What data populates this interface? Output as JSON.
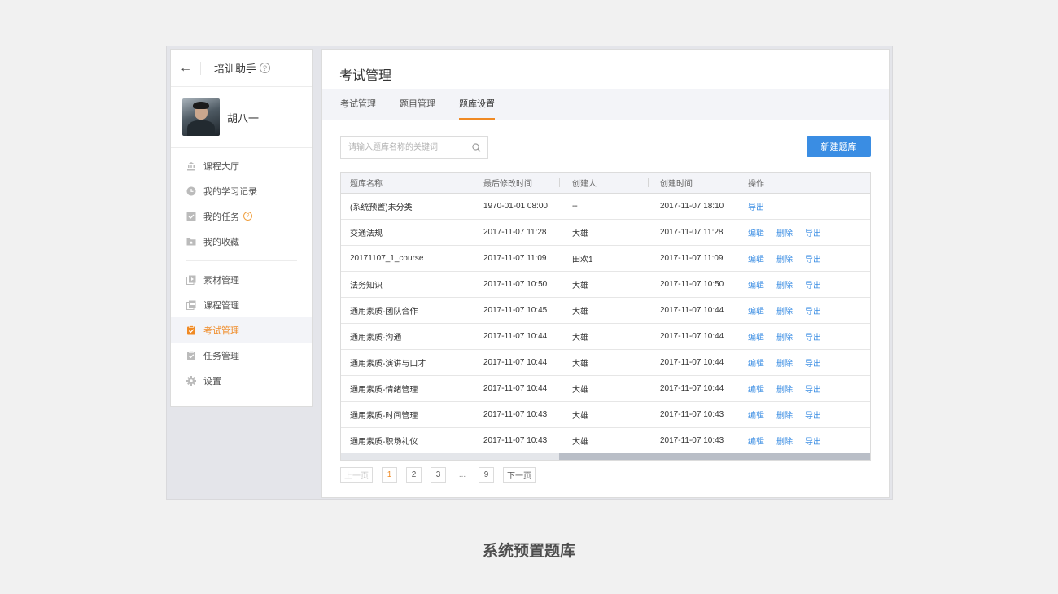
{
  "sidebar": {
    "app_title": "培训助手",
    "help_glyph": "?",
    "user_name": "胡八一",
    "items": [
      {
        "label": "课程大厅"
      },
      {
        "label": "我的学习记录"
      },
      {
        "label": "我的任务",
        "badge": "?"
      },
      {
        "label": "我的收藏"
      },
      {
        "label": "素材管理"
      },
      {
        "label": "课程管理"
      },
      {
        "label": "考试管理",
        "active": true
      },
      {
        "label": "任务管理"
      },
      {
        "label": "设置"
      }
    ]
  },
  "main": {
    "title": "考试管理",
    "tabs": [
      "考试管理",
      "题目管理",
      "题库设置"
    ],
    "active_tab": "题库设置",
    "search_placeholder": "请输入题库名称的关键词",
    "new_button": "新建题库",
    "table": {
      "columns": [
        "题库名称",
        "最后修改时间",
        "创建人",
        "创建时间",
        "操作"
      ],
      "rows": [
        {
          "name": "(系统预置)未分类",
          "modified": "1970-01-01 08:00",
          "creator": "--",
          "created": "2017-11-07 18:10",
          "ops": [
            "导出"
          ]
        },
        {
          "name": "交通法规",
          "modified": "2017-11-07 11:28",
          "creator": "大雄",
          "created": "2017-11-07 11:28",
          "ops": [
            "编辑",
            "删除",
            "导出"
          ]
        },
        {
          "name": "20171107_1_course",
          "modified": "2017-11-07 11:09",
          "creator": "田欢1",
          "created": "2017-11-07 11:09",
          "ops": [
            "编辑",
            "删除",
            "导出"
          ]
        },
        {
          "name": "法务知识",
          "modified": "2017-11-07 10:50",
          "creator": "大雄",
          "created": "2017-11-07 10:50",
          "ops": [
            "编辑",
            "删除",
            "导出"
          ]
        },
        {
          "name": "通用素质-团队合作",
          "modified": "2017-11-07 10:45",
          "creator": "大雄",
          "created": "2017-11-07 10:44",
          "ops": [
            "编辑",
            "删除",
            "导出"
          ]
        },
        {
          "name": "通用素质-沟通",
          "modified": "2017-11-07 10:44",
          "creator": "大雄",
          "created": "2017-11-07 10:44",
          "ops": [
            "编辑",
            "删除",
            "导出"
          ]
        },
        {
          "name": "通用素质-演讲与口才",
          "modified": "2017-11-07 10:44",
          "creator": "大雄",
          "created": "2017-11-07 10:44",
          "ops": [
            "编辑",
            "删除",
            "导出"
          ]
        },
        {
          "name": "通用素质-情绪管理",
          "modified": "2017-11-07 10:44",
          "creator": "大雄",
          "created": "2017-11-07 10:44",
          "ops": [
            "编辑",
            "删除",
            "导出"
          ]
        },
        {
          "name": "通用素质-时间管理",
          "modified": "2017-11-07 10:43",
          "creator": "大雄",
          "created": "2017-11-07 10:43",
          "ops": [
            "编辑",
            "删除",
            "导出"
          ]
        },
        {
          "name": "通用素质-职场礼仪",
          "modified": "2017-11-07 10:43",
          "creator": "大雄",
          "created": "2017-11-07 10:43",
          "ops": [
            "编辑",
            "删除",
            "导出"
          ]
        }
      ]
    },
    "pagination": {
      "prev": "上一页",
      "next": "下一页",
      "pages": [
        "1",
        "2",
        "3",
        "...",
        "9"
      ],
      "current": "1"
    }
  },
  "caption": "系统预置题库",
  "colors": {
    "accent": "#f08a24",
    "primary": "#3a8de3"
  },
  "icons": [
    "back-arrow-icon",
    "help-circle-icon",
    "bank-icon",
    "clock-icon",
    "task-icon",
    "folder-icon",
    "material-icon",
    "course-icon",
    "exam-icon",
    "task-manage-icon",
    "gear-icon",
    "search-icon"
  ]
}
